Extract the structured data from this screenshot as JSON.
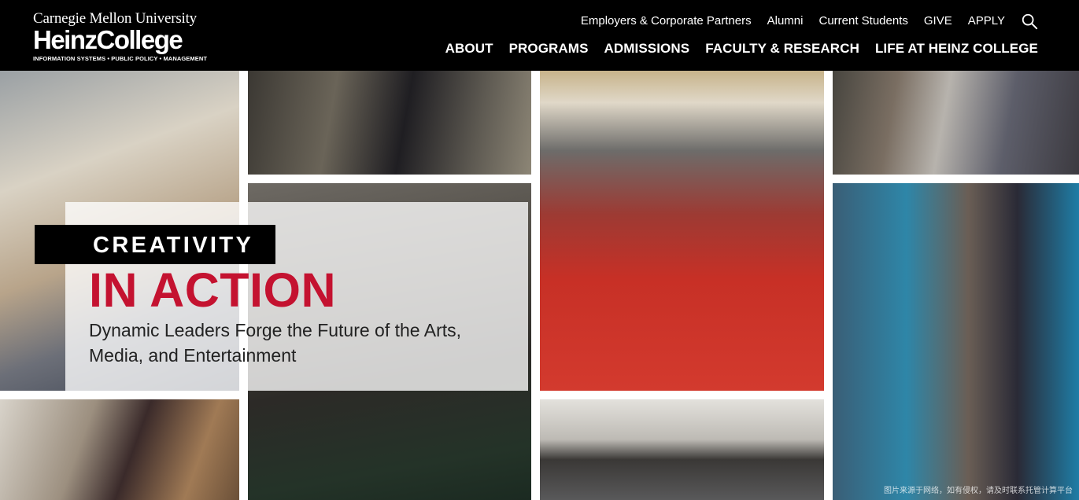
{
  "logo": {
    "university": "Carnegie Mellon University",
    "college": "HeinzCollege",
    "tagline": "INFORMATION SYSTEMS • PUBLIC POLICY • MANAGEMENT"
  },
  "utility_nav": [
    {
      "label": "Employers & Corporate Partners"
    },
    {
      "label": "Alumni"
    },
    {
      "label": "Current Students"
    },
    {
      "label": "GIVE"
    },
    {
      "label": "APPLY"
    }
  ],
  "search_icon": "search-icon",
  "main_nav": [
    {
      "label": "ABOUT"
    },
    {
      "label": "PROGRAMS"
    },
    {
      "label": "ADMISSIONS"
    },
    {
      "label": "FACULTY & RESEARCH"
    },
    {
      "label": "LIFE AT HEINZ COLLEGE"
    }
  ],
  "hero": {
    "badge": "CREATIVITY",
    "headline": "IN ACTION",
    "subhead": "Dynamic Leaders Forge the Future of the Arts, Media, and Entertainment"
  },
  "watermark": "图片来源于网络，如有侵权，请及时联系托管计算平台",
  "colors": {
    "header_bg": "#000000",
    "accent_red": "#c41230",
    "text_dark": "#222222"
  }
}
